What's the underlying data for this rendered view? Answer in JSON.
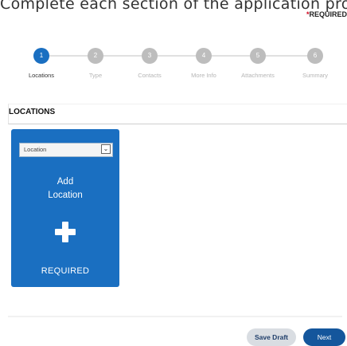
{
  "header": {
    "intro_text": "Complete each section of the application process.",
    "required_star": "*",
    "required_text": "REQUIRED"
  },
  "stepper": {
    "steps": [
      {
        "number": "1",
        "label": "Locations",
        "active": true
      },
      {
        "number": "2",
        "label": "Type",
        "active": false
      },
      {
        "number": "3",
        "label": "Contacts",
        "active": false
      },
      {
        "number": "4",
        "label": "More Info",
        "active": false
      },
      {
        "number": "5",
        "label": "Attachments",
        "active": false
      },
      {
        "number": "6",
        "label": "Summary",
        "active": false
      }
    ]
  },
  "section": {
    "title": "LOCATIONS"
  },
  "location_card": {
    "select_value": "Location",
    "add_label_line1": "Add",
    "add_label_line2": "Location",
    "required_label": "REQUIRED"
  },
  "actions": {
    "save_draft_label": "Save Draft",
    "next_label": "Next"
  },
  "colors": {
    "accent": "#1a6fc1",
    "next_button": "#14569c",
    "inactive_step": "#bdbdbd",
    "required_star": "#d0021b"
  }
}
